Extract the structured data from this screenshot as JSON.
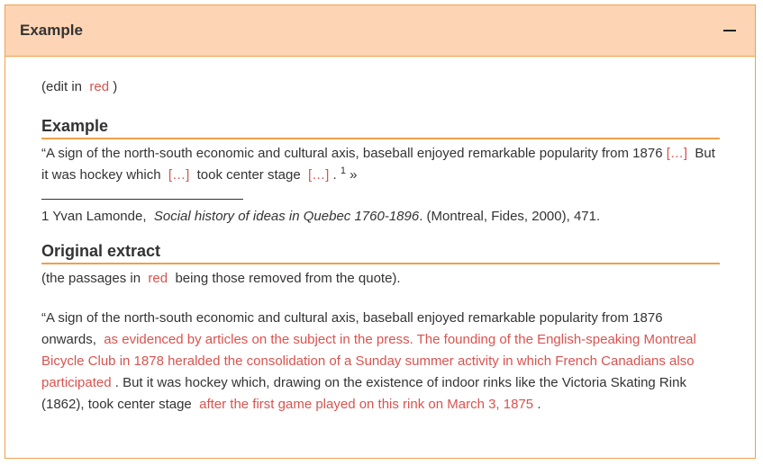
{
  "header": {
    "title": "Example"
  },
  "edit_note": {
    "prefix": "(edit in",
    "red_word": "red",
    "suffix": ")"
  },
  "example": {
    "heading": "Example",
    "quote_part1": "“A sign of the north-south economic and cultural axis, baseball enjoyed remarkable popularity from 1876",
    "ellipsis1": "[…]",
    "quote_part2": "But it was hockey which",
    "ellipsis2": "[…]",
    "quote_part3": "took center stage",
    "ellipsis3": "[…]",
    "dot": ".",
    "footnote_ref": "1",
    "close_quote": "»"
  },
  "footnote": {
    "number": "1",
    "author": "Yvan Lamonde,",
    "title": "Social history of ideas in Quebec 1760-1896",
    "rest": ". (Montreal, Fides, 2000), 471."
  },
  "original": {
    "heading": "Original extract",
    "note_prefix": "(the passages in",
    "note_red": "red",
    "note_suffix": "being those removed from the quote).",
    "text1": "“A sign of the north-south economic and cultural axis, baseball enjoyed remarkable popularity from 1876 onwards,",
    "removed1": "as evidenced by articles on the subject in the press. The founding of the English-speaking Montreal Bicycle Club in 1878 heralded the consolidation of a Sunday summer activity in which French Canadians also participated",
    "text2": ". But it was hockey which, drawing on the existence of indoor rinks like the Victoria Skating Rink (1862), took center stage",
    "removed2": "after the first game played on this rink on March 3, 1875",
    "text3": "."
  },
  "colors": {
    "accent": "#f0a04b",
    "header_bg": "#fdd5b4",
    "removed_text": "#d9534f"
  }
}
